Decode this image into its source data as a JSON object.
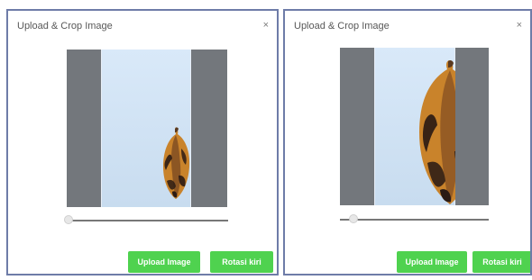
{
  "dialogs": [
    {
      "title": "Upload & Crop Image",
      "close_label": "×",
      "buttons": {
        "upload": "Upload Image",
        "rotate": "Rotasi kiri"
      },
      "zoom_level_fraction": 0.0
    },
    {
      "title": "Upload & Crop Image",
      "close_label": "×",
      "buttons": {
        "upload": "Upload Image",
        "rotate": "Rotasi kiri"
      },
      "zoom_level_fraction": 0.1
    }
  ],
  "colors": {
    "accent": "#4fd24f",
    "border": "#6e7ca8",
    "overlay": "#73777c",
    "image_background": "#d9e9f9",
    "cocoa_orange": "#c9832b",
    "cocoa_dark": "#2b1b14"
  },
  "icons": {
    "close": "close-icon",
    "image": "cocoa-pod-image"
  }
}
